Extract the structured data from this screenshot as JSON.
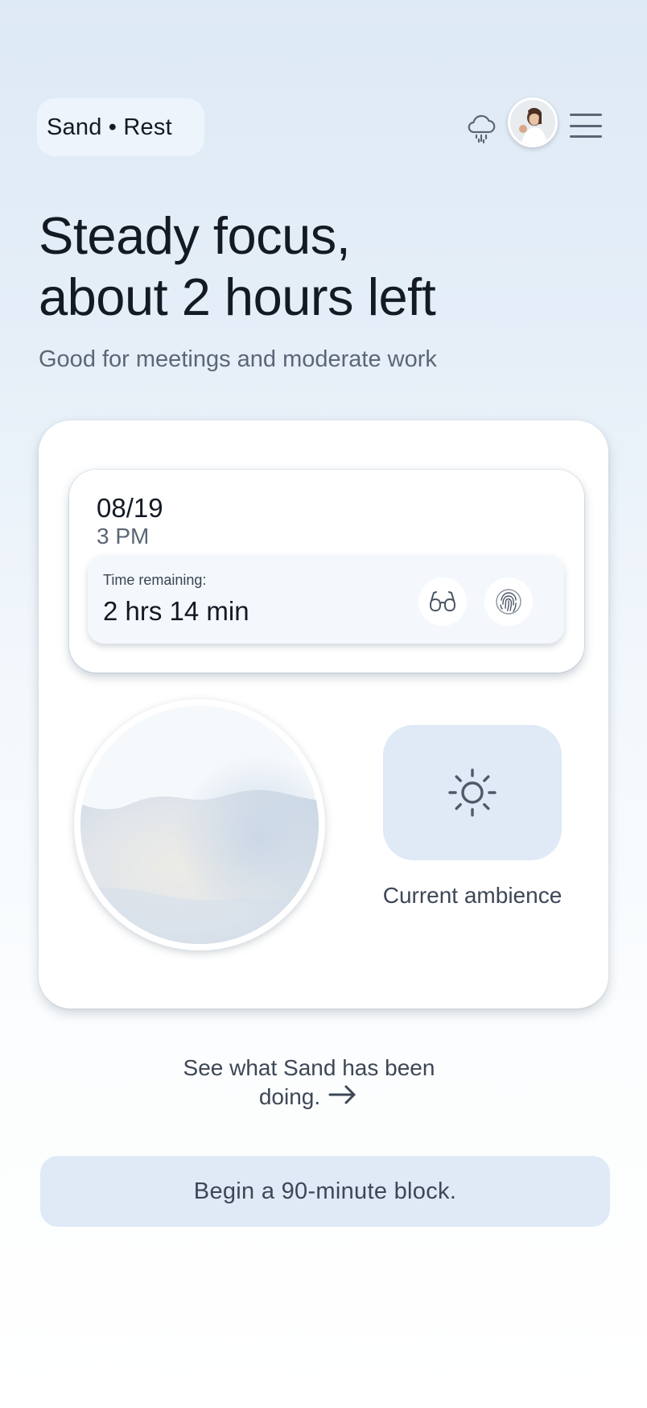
{
  "header": {
    "brand": "Sand • Rest",
    "icons": [
      "cloud-rain-icon",
      "avatar",
      "menu-icon"
    ]
  },
  "hero": {
    "title_line1": "Steady focus,",
    "title_line2": "about 2 hours left",
    "subtitle": "Good for meetings and moderate work"
  },
  "status": {
    "date": "08/19",
    "time": "3 PM",
    "remaining_label": "Time remaining:",
    "remaining_value": "2 hrs 14 min",
    "actions": [
      "glasses-icon",
      "fingerprint-icon"
    ]
  },
  "ambience": {
    "icon": "sun-icon",
    "label": "Current ambience"
  },
  "activity_link": {
    "line1": "See what Sand has been",
    "line2": "doing."
  },
  "cta": {
    "label": "Begin a 90-minute block."
  },
  "colors": {
    "background_top": "#dde9f5",
    "accent_soft": "#dfeaf6",
    "text_primary": "#131a24",
    "text_secondary": "#5b6676"
  }
}
